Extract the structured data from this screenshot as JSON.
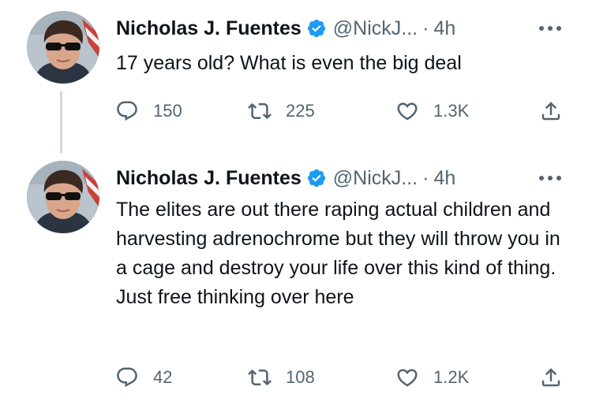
{
  "tweets": [
    {
      "name": "Nicholas J. Fuentes",
      "handle": "@NickJ...",
      "separator": "·",
      "time": "4h",
      "text": "17 years old? What is even the big deal",
      "replies": "150",
      "retweets": "225",
      "likes": "1.3K"
    },
    {
      "name": "Nicholas J. Fuentes",
      "handle": "@NickJ...",
      "separator": "·",
      "time": "4h",
      "text": "The elites are out there raping actual children and harvesting adrenochrome but they will throw you in a cage and destroy your life over this kind of thing. Just free thinking over here",
      "replies": "42",
      "retweets": "108",
      "likes": "1.2K"
    }
  ],
  "icons": {
    "verified": "verified-badge-icon",
    "more": "more-horizontal-icon",
    "reply": "reply-icon",
    "retweet": "retweet-icon",
    "like": "heart-icon",
    "share": "share-icon"
  },
  "colors": {
    "verified_blue": "#1d9bf0",
    "secondary_text": "#536471",
    "primary_text": "#0f1419",
    "thread_line": "#cfd9de"
  }
}
